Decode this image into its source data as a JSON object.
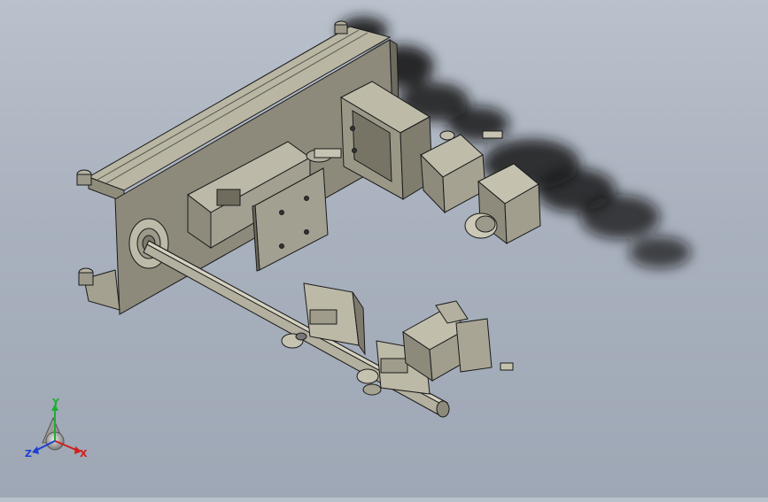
{
  "app": {
    "type": "3D CAD assembly viewport"
  },
  "triad": {
    "x_label": "X",
    "y_label": "Y",
    "z_label": "Z",
    "colors": {
      "x": "#d21e1e",
      "y": "#1fae2f",
      "z": "#1f3fd0"
    }
  },
  "colors": {
    "part_light": "#c9c6b4",
    "part_mid": "#a19e8d",
    "part_dark": "#6f6c5e",
    "edge": "#1a1a1a",
    "smoke": "#151515"
  }
}
